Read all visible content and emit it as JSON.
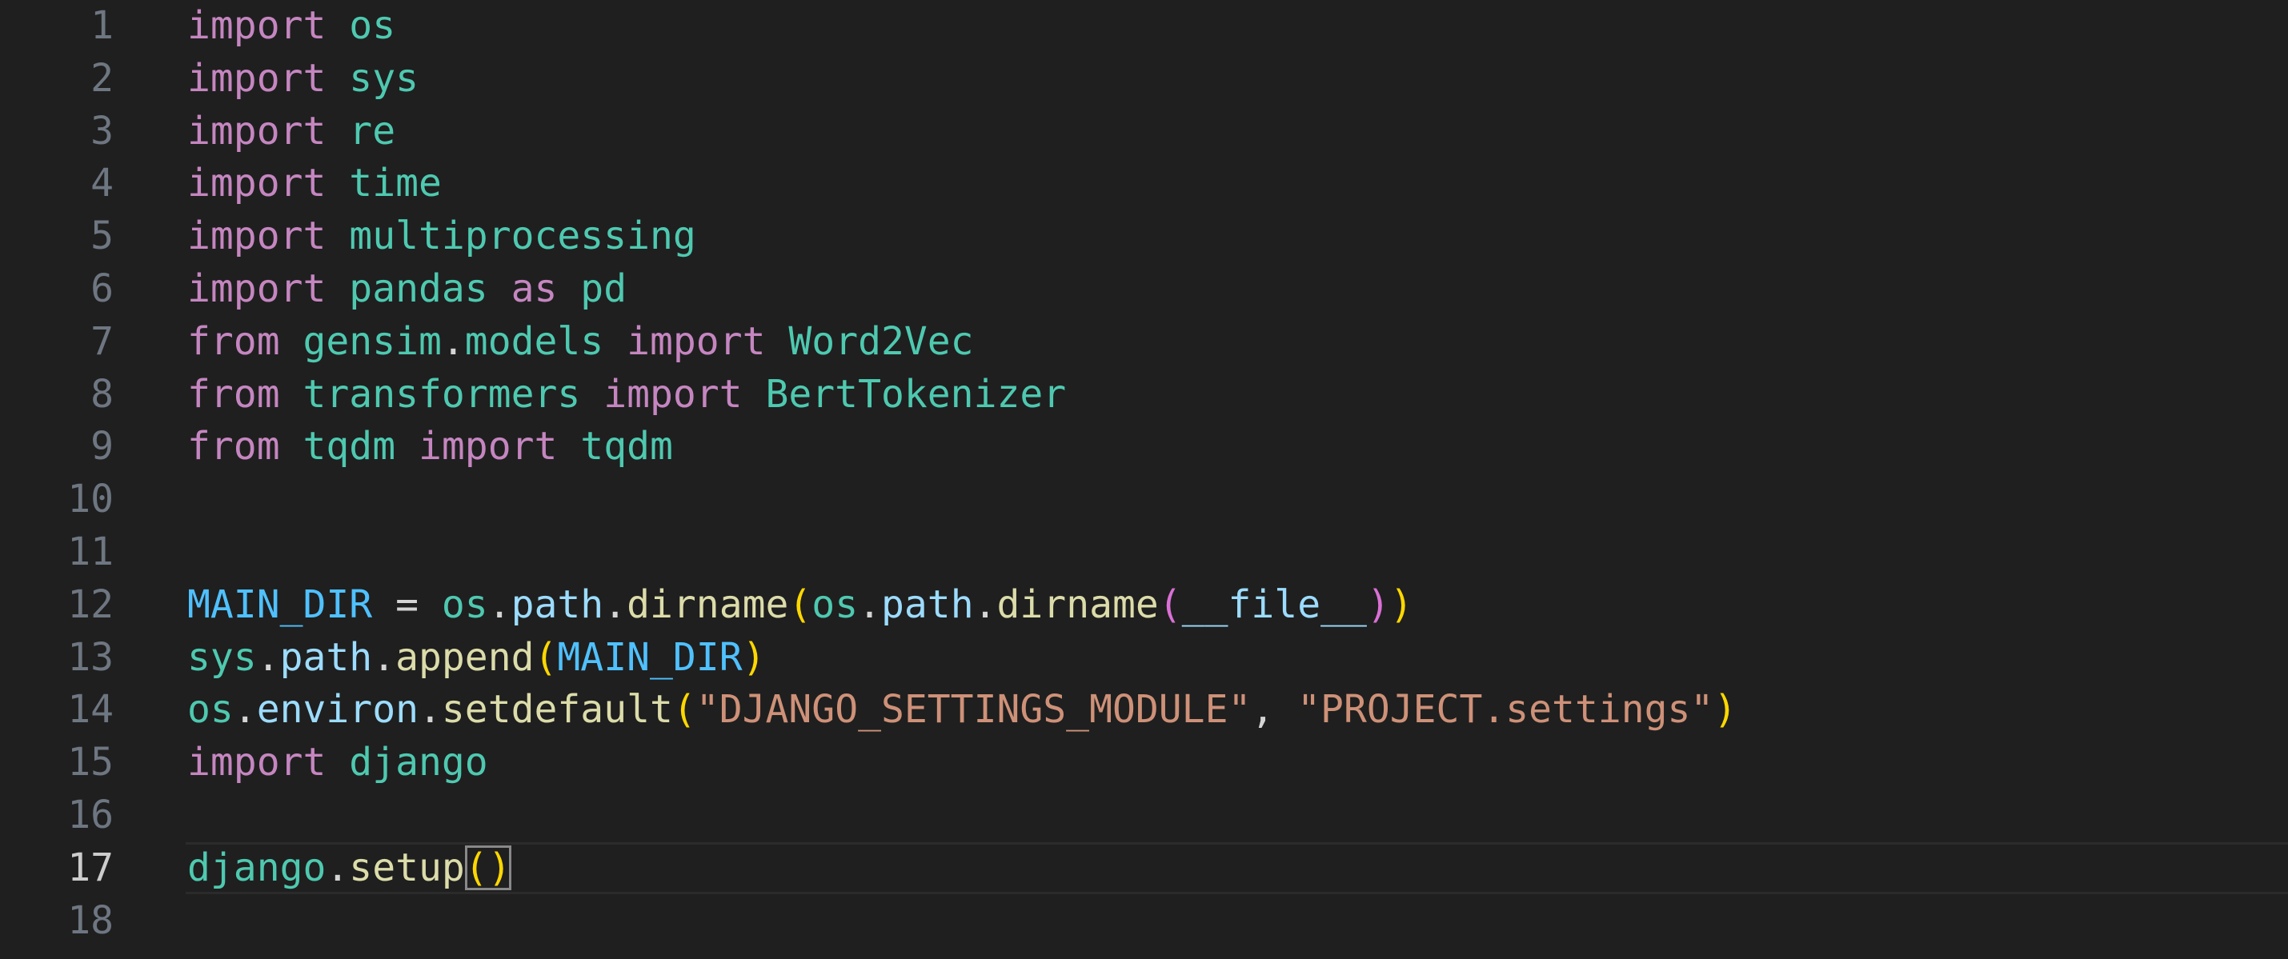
{
  "editor": {
    "language": "python",
    "current_line": 17,
    "colors": {
      "background": "#1f1f1f",
      "line_number": "#6e7681",
      "line_number_active": "#cccccc",
      "keyword": "#c586c0",
      "module": "#4ec9b0",
      "variable": "#9cdcfe",
      "constant": "#4fc1ff",
      "function": "#dcdcaa",
      "string": "#ce9178",
      "bracket_level1": "#ffd700",
      "bracket_level2": "#da70d6"
    },
    "lines": [
      {
        "num": "1",
        "tokens": [
          [
            "kw",
            "import"
          ],
          [
            "op",
            " "
          ],
          [
            "mod",
            "os"
          ]
        ]
      },
      {
        "num": "2",
        "tokens": [
          [
            "kw",
            "import"
          ],
          [
            "op",
            " "
          ],
          [
            "mod",
            "sys"
          ]
        ]
      },
      {
        "num": "3",
        "tokens": [
          [
            "kw",
            "import"
          ],
          [
            "op",
            " "
          ],
          [
            "mod",
            "re"
          ]
        ]
      },
      {
        "num": "4",
        "tokens": [
          [
            "kw",
            "import"
          ],
          [
            "op",
            " "
          ],
          [
            "mod",
            "time"
          ]
        ]
      },
      {
        "num": "5",
        "tokens": [
          [
            "kw",
            "import"
          ],
          [
            "op",
            " "
          ],
          [
            "mod",
            "multiprocessing"
          ]
        ]
      },
      {
        "num": "6",
        "tokens": [
          [
            "kw",
            "import"
          ],
          [
            "op",
            " "
          ],
          [
            "mod",
            "pandas"
          ],
          [
            "op",
            " "
          ],
          [
            "kw",
            "as"
          ],
          [
            "op",
            " "
          ],
          [
            "mod",
            "pd"
          ]
        ]
      },
      {
        "num": "7",
        "tokens": [
          [
            "kw",
            "from"
          ],
          [
            "op",
            " "
          ],
          [
            "mod",
            "gensim"
          ],
          [
            "op",
            "."
          ],
          [
            "mod",
            "models"
          ],
          [
            "op",
            " "
          ],
          [
            "kw",
            "import"
          ],
          [
            "op",
            " "
          ],
          [
            "mod",
            "Word2Vec"
          ]
        ]
      },
      {
        "num": "8",
        "tokens": [
          [
            "kw",
            "from"
          ],
          [
            "op",
            " "
          ],
          [
            "mod",
            "transformers"
          ],
          [
            "op",
            " "
          ],
          [
            "kw",
            "import"
          ],
          [
            "op",
            " "
          ],
          [
            "mod",
            "BertTokenizer"
          ]
        ]
      },
      {
        "num": "9",
        "tokens": [
          [
            "kw",
            "from"
          ],
          [
            "op",
            " "
          ],
          [
            "mod",
            "tqdm"
          ],
          [
            "op",
            " "
          ],
          [
            "kw",
            "import"
          ],
          [
            "op",
            " "
          ],
          [
            "mod",
            "tqdm"
          ]
        ]
      },
      {
        "num": "10",
        "tokens": []
      },
      {
        "num": "11",
        "tokens": []
      },
      {
        "num": "12",
        "tokens": [
          [
            "const",
            "MAIN_DIR"
          ],
          [
            "op",
            " = "
          ],
          [
            "mod",
            "os"
          ],
          [
            "op",
            "."
          ],
          [
            "var",
            "path"
          ],
          [
            "op",
            "."
          ],
          [
            "fn",
            "dirname"
          ],
          [
            "b1",
            "("
          ],
          [
            "mod",
            "os"
          ],
          [
            "op",
            "."
          ],
          [
            "var",
            "path"
          ],
          [
            "op",
            "."
          ],
          [
            "fn",
            "dirname"
          ],
          [
            "b2",
            "("
          ],
          [
            "var",
            "__file__"
          ],
          [
            "b2",
            ")"
          ],
          [
            "b1",
            ")"
          ]
        ]
      },
      {
        "num": "13",
        "tokens": [
          [
            "mod",
            "sys"
          ],
          [
            "op",
            "."
          ],
          [
            "var",
            "path"
          ],
          [
            "op",
            "."
          ],
          [
            "fn",
            "append"
          ],
          [
            "b1",
            "("
          ],
          [
            "const",
            "MAIN_DIR"
          ],
          [
            "b1",
            ")"
          ]
        ]
      },
      {
        "num": "14",
        "tokens": [
          [
            "mod",
            "os"
          ],
          [
            "op",
            "."
          ],
          [
            "var",
            "environ"
          ],
          [
            "op",
            "."
          ],
          [
            "fn",
            "setdefault"
          ],
          [
            "b1",
            "("
          ],
          [
            "str",
            "\"DJANGO_SETTINGS_MODULE\""
          ],
          [
            "op",
            ", "
          ],
          [
            "str",
            "\"PROJECT.settings\""
          ],
          [
            "b1",
            ")"
          ]
        ]
      },
      {
        "num": "15",
        "tokens": [
          [
            "kw",
            "import"
          ],
          [
            "op",
            " "
          ],
          [
            "mod",
            "django"
          ]
        ]
      },
      {
        "num": "16",
        "tokens": []
      },
      {
        "num": "17",
        "tokens": [
          [
            "mod",
            "django"
          ],
          [
            "op",
            "."
          ],
          [
            "fn",
            "setup"
          ],
          [
            "b1 match",
            "()"
          ]
        ]
      },
      {
        "num": "18",
        "tokens": []
      }
    ]
  }
}
